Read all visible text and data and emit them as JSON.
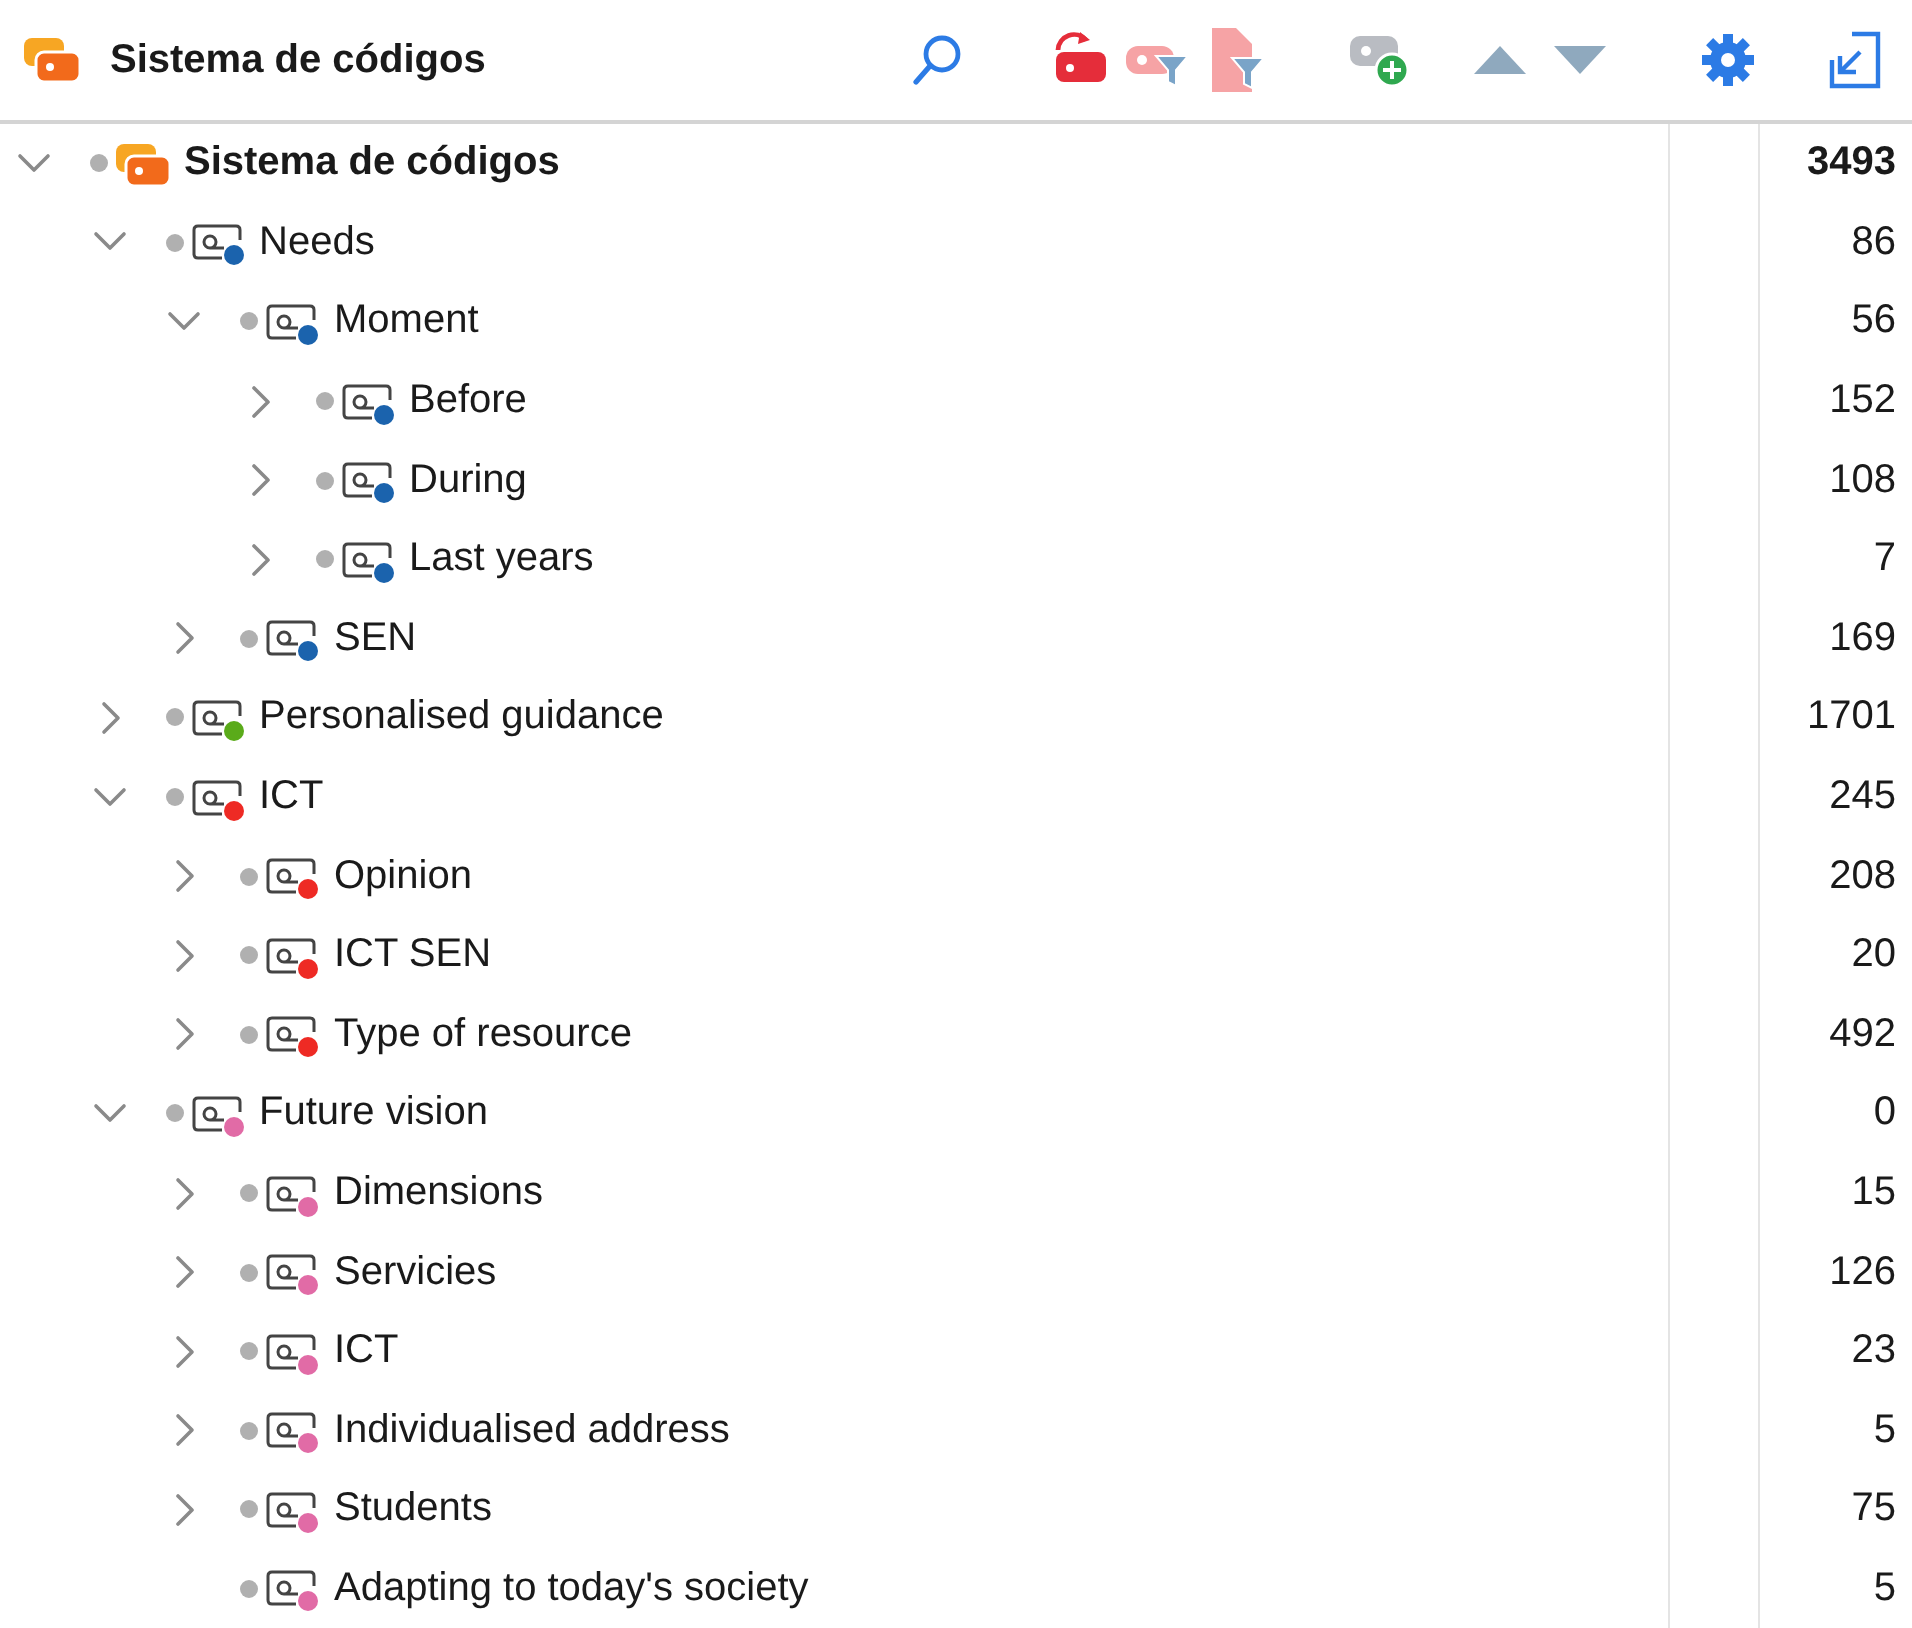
{
  "header": {
    "title": "Sistema de códigos"
  },
  "tree": [
    {
      "label": "Sistema de códigos",
      "count": "3493",
      "kind": "system",
      "expanded": true,
      "children": [
        {
          "label": "Needs",
          "count": "86",
          "kind": "code",
          "color": "#1b63ad",
          "expanded": true,
          "children": [
            {
              "label": "Moment",
              "count": "56",
              "kind": "code",
              "color": "#1b63ad",
              "expanded": true,
              "children": [
                {
                  "label": "Before",
                  "count": "152",
                  "kind": "code",
                  "color": "#1b63ad",
                  "expanded": false
                },
                {
                  "label": "During",
                  "count": "108",
                  "kind": "code",
                  "color": "#1b63ad",
                  "expanded": false
                },
                {
                  "label": "Last years",
                  "count": "7",
                  "kind": "code",
                  "color": "#1b63ad",
                  "expanded": false
                }
              ]
            },
            {
              "label": "SEN",
              "count": "169",
              "kind": "code",
              "color": "#1b63ad",
              "expanded": false
            }
          ]
        },
        {
          "label": "Personalised guidance",
          "count": "1701",
          "kind": "code",
          "color": "#5aab1a",
          "expanded": false
        },
        {
          "label": "ICT",
          "count": "245",
          "kind": "code",
          "color": "#ee2a24",
          "expanded": true,
          "children": [
            {
              "label": "Opinion",
              "count": "208",
              "kind": "code",
              "color": "#ee2a24",
              "expanded": false
            },
            {
              "label": "ICT SEN",
              "count": "20",
              "kind": "code",
              "color": "#ee2a24",
              "expanded": false
            },
            {
              "label": "Type of resource",
              "count": "492",
              "kind": "code",
              "color": "#ee2a24",
              "expanded": false
            }
          ]
        },
        {
          "label": "Future vision",
          "count": "0",
          "kind": "code",
          "color": "#e16ba6",
          "expanded": true,
          "children": [
            {
              "label": "Dimensions",
              "count": "15",
              "kind": "code",
              "color": "#e16ba6",
              "expanded": false
            },
            {
              "label": "Servicies",
              "count": "126",
              "kind": "code",
              "color": "#e16ba6",
              "expanded": false
            },
            {
              "label": "ICT",
              "count": "23",
              "kind": "code",
              "color": "#e16ba6",
              "expanded": false
            },
            {
              "label": "Individualised address",
              "count": "5",
              "kind": "code",
              "color": "#e16ba6",
              "expanded": false
            },
            {
              "label": "Students",
              "count": "75",
              "kind": "code",
              "color": "#e16ba6",
              "expanded": false
            },
            {
              "label": "Adapting to today's society",
              "count": "5",
              "kind": "leaf",
              "color": "#e16ba6"
            }
          ]
        }
      ]
    }
  ]
}
